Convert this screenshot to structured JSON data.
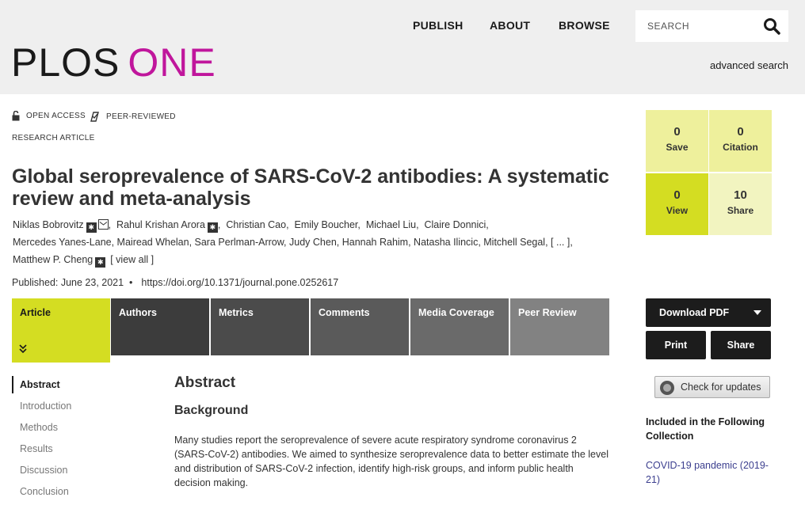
{
  "header": {
    "logo_plos": "PLOS",
    "logo_one": "ONE",
    "nav": [
      "PUBLISH",
      "ABOUT",
      "BROWSE"
    ],
    "search_placeholder": "SEARCH",
    "advanced_search": "advanced search"
  },
  "badges": {
    "open_access": "OPEN ACCESS",
    "peer_reviewed": "PEER-REVIEWED",
    "article_type": "RESEARCH ARTICLE"
  },
  "article": {
    "title": "Global seroprevalence of SARS-CoV-2 antibodies: A systematic review and meta-analysis",
    "authors_line1": [
      "Niklas Bobrovitz",
      "Rahul Krishan Arora",
      "Christian Cao",
      "Emily Boucher",
      "Michael Liu",
      "Claire Donnici,"
    ],
    "authors_line2": "Mercedes Yanes-Lane,  Mairead Whelan,  Sara Perlman-Arrow,  Judy Chen,  Hannah Rahim,  Natasha Ilincic,  Mitchell Segal,  [ ... ],",
    "authors_line3": "Matthew P. Cheng",
    "view_all": "[ view all ]",
    "published": "Published: June 23, 2021",
    "doi": "https://doi.org/10.1371/journal.pone.0252617"
  },
  "tabs": [
    "Article",
    "Authors",
    "Metrics",
    "Comments",
    "Media Coverage",
    "Peer Review"
  ],
  "toc": [
    "Abstract",
    "Introduction",
    "Methods",
    "Results",
    "Discussion",
    "Conclusion"
  ],
  "content": {
    "abstract_heading": "Abstract",
    "background_heading": "Background",
    "background_text": "Many studies report the seroprevalence of severe acute respiratory syndrome coronavirus 2 (SARS-CoV-2) antibodies. We aimed to synthesize seroprevalence data to better estimate the level and distribution of SARS-CoV-2 infection, identify high-risk groups, and inform public health decision making."
  },
  "metrics": {
    "save": {
      "value": "0",
      "label": "Save"
    },
    "citation": {
      "value": "0",
      "label": "Citation"
    },
    "view": {
      "value": "0",
      "label": "View"
    },
    "share": {
      "value": "10",
      "label": "Share"
    }
  },
  "actions": {
    "download_pdf": "Download PDF",
    "print": "Print",
    "share": "Share",
    "check_updates": "Check for updates"
  },
  "sidebar": {
    "included_heading": "Included in the Following Collection",
    "collection_link": "COVID-19 pandemic (2019-21)"
  },
  "colors": {
    "accent_magenta": "#c0169c",
    "accent_lime": "#d4dd22"
  }
}
